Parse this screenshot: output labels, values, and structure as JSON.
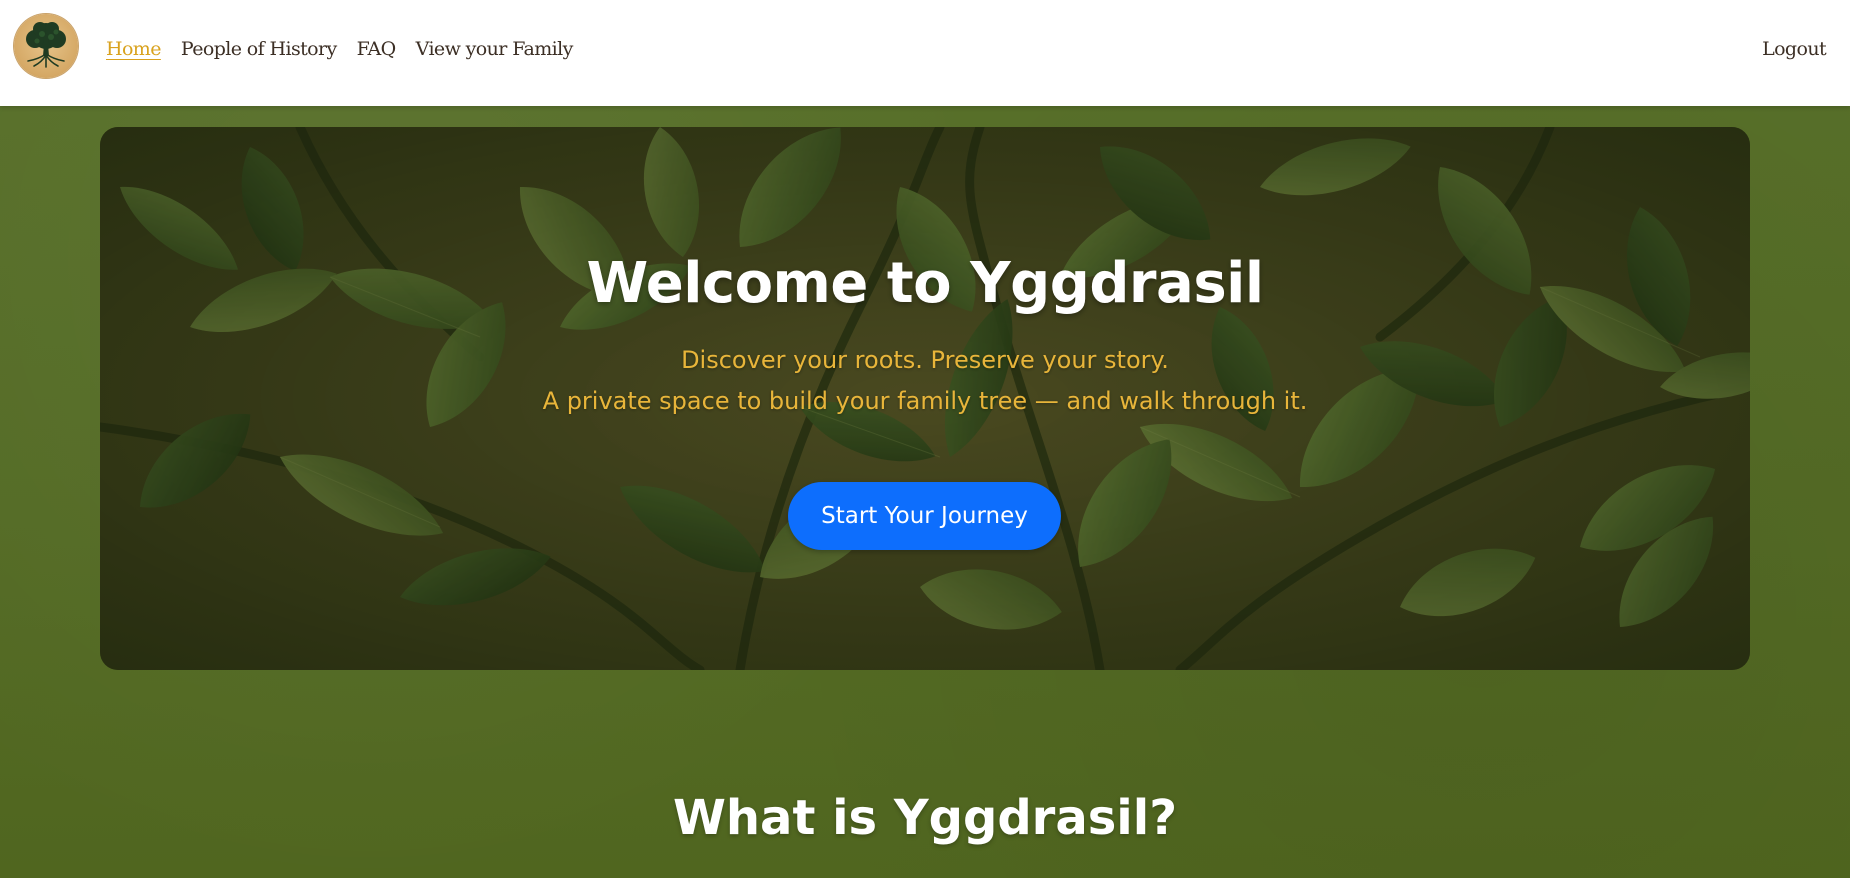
{
  "nav": {
    "logo_icon": "tree-of-life-icon",
    "links": [
      {
        "label": "Home",
        "active": true
      },
      {
        "label": "People of History",
        "active": false
      },
      {
        "label": "FAQ",
        "active": false
      },
      {
        "label": "View your Family",
        "active": false
      }
    ],
    "logout_label": "Logout"
  },
  "hero": {
    "title": "Welcome to Yggdrasil",
    "subtitle_line1": "Discover your roots. Preserve your story.",
    "subtitle_line2": "A private space to build your family tree — and walk through it.",
    "cta_label": "Start Your Journey",
    "background_icon": "leaves-background-image"
  },
  "section": {
    "title": "What is Yggdrasil?"
  },
  "colors": {
    "page_background": "#566c26",
    "nav_active": "#d9a21e",
    "subtitle": "#e8b53a",
    "cta": "#0d6efd"
  }
}
